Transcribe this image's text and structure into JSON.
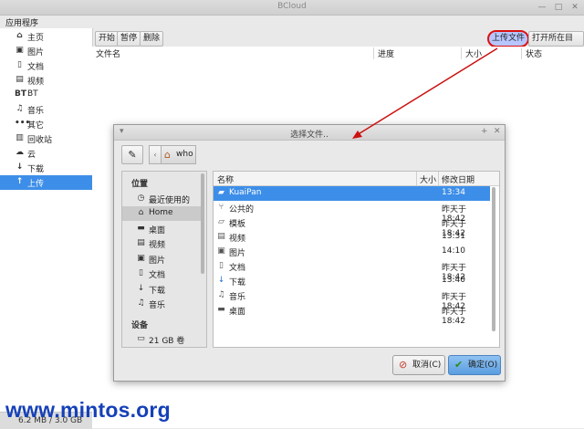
{
  "window": {
    "title": "BCloud",
    "btn_min": "—",
    "btn_max": "□",
    "btn_close": "✕"
  },
  "menubar": {
    "app_menu": "应用程序"
  },
  "sidebar": {
    "items": [
      {
        "icon": "⌂",
        "label": "主页"
      },
      {
        "icon": "▣",
        "label": "图片"
      },
      {
        "icon": "▯",
        "label": "文档"
      },
      {
        "icon": "▤",
        "label": "视频"
      },
      {
        "icon": "BT",
        "label": "BT"
      },
      {
        "icon": "♫",
        "label": "音乐"
      },
      {
        "icon": "•••",
        "label": "其它"
      },
      {
        "icon": "▥",
        "label": "回收站"
      },
      {
        "icon": "☁",
        "label": "云"
      },
      {
        "icon": "↓",
        "label": "下载"
      },
      {
        "icon": "↑",
        "label": "上传"
      }
    ],
    "active_index": 10
  },
  "status": {
    "quota": "6.2 MB / 3.0 GB"
  },
  "toolbar": {
    "start": "开始",
    "pause": "暂停",
    "delete": "删除",
    "upload": "上传文件",
    "open_folder": "打开所在目录"
  },
  "list": {
    "col_name": "文件名",
    "col_progress": "进度",
    "col_size": "大小",
    "col_status": "状态"
  },
  "dialog": {
    "title": "选择文件..",
    "menu_glyph": "▾",
    "add_glyph": "+",
    "close_glyph": "✕",
    "edit_glyph": "✎",
    "path_left": "‹",
    "path_home_icon": "⌂",
    "path_current": "who",
    "places_header": "位置",
    "places": [
      {
        "icon": "◷",
        "label": "最近使用的"
      },
      {
        "icon": "⌂",
        "label": "Home"
      },
      {
        "icon": "▬",
        "label": "桌面"
      },
      {
        "icon": "▤",
        "label": "视频"
      },
      {
        "icon": "▣",
        "label": "图片"
      },
      {
        "icon": "▯",
        "label": "文档"
      },
      {
        "icon": "↓",
        "label": "下载"
      },
      {
        "icon": "♫",
        "label": "音乐"
      }
    ],
    "places_selected": 1,
    "devices_header": "设备",
    "devices": [
      {
        "icon": "▭",
        "label": "21 GB 卷"
      }
    ],
    "col_name": "名称",
    "col_size": "大小",
    "col_modified": "修改日期",
    "files": [
      {
        "icon": "▰",
        "name": "KuaiPan",
        "date": "13:34"
      },
      {
        "icon": "⑂",
        "name": "公共的",
        "date": "昨天于 18:42"
      },
      {
        "icon": "▱",
        "name": "模板",
        "date": "昨天于 18:42"
      },
      {
        "icon": "▤",
        "name": "视频",
        "date": "13:31"
      },
      {
        "icon": "▣",
        "name": "图片",
        "date": "14:10"
      },
      {
        "icon": "▯",
        "name": "文档",
        "date": "昨天于 18:42"
      },
      {
        "icon": "↓",
        "name": "下载",
        "date": "13:40"
      },
      {
        "icon": "♫",
        "name": "音乐",
        "date": "昨天于 18:42"
      },
      {
        "icon": "▬",
        "name": "桌面",
        "date": "昨天于 18:42"
      }
    ],
    "files_selected": 0,
    "cancel": {
      "icon": "⊘",
      "label": "取消(C)"
    },
    "ok": {
      "icon": "✔",
      "label": "确定(O)"
    }
  },
  "colors": {
    "accent": "#3d8ee8",
    "highlight_ring": "#dd1111",
    "arrow": "#cc1111",
    "watermark": "#1540b8"
  },
  "watermark": "www.mintos.org"
}
